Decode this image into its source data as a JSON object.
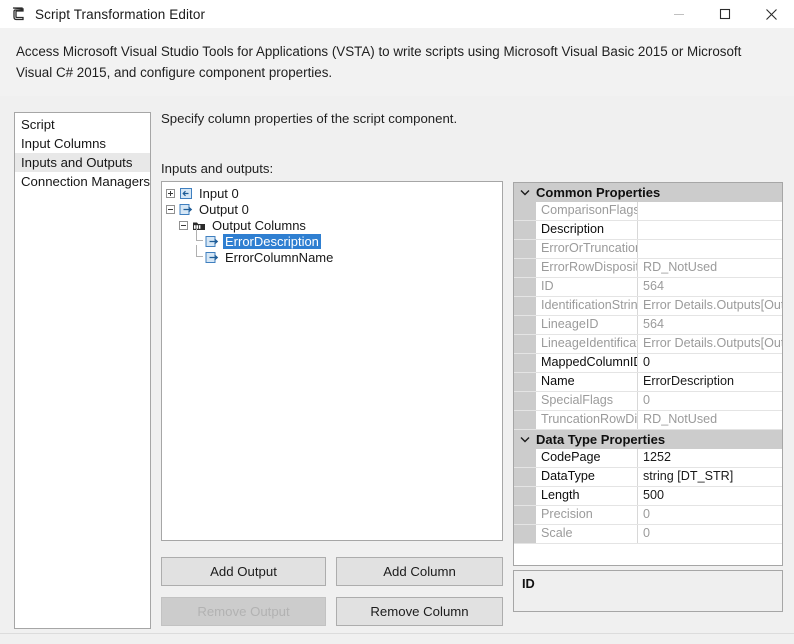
{
  "window": {
    "title": "Script Transformation Editor",
    "icon": "script-transformation-icon",
    "controls": {
      "minimize": "minimize-icon",
      "maximize": "maximize-icon",
      "close": "close-icon"
    }
  },
  "header": {
    "description": "Access Microsoft Visual Studio Tools for Applications (VSTA) to write scripts using Microsoft Visual Basic 2015 or Microsoft Visual C# 2015, and configure component properties."
  },
  "nav": {
    "items": [
      {
        "label": "Script",
        "selected": false
      },
      {
        "label": "Input Columns",
        "selected": false
      },
      {
        "label": "Inputs and Outputs",
        "selected": true
      },
      {
        "label": "Connection Managers",
        "selected": false
      }
    ]
  },
  "main": {
    "instruction": "Specify column properties of the script component.",
    "tree_label": "Inputs and outputs:"
  },
  "tree": {
    "nodes": [
      {
        "label": "Input 0",
        "depth": 0,
        "expander": "plus",
        "icon": "input-icon",
        "selected": false
      },
      {
        "label": "Output 0",
        "depth": 0,
        "expander": "minus",
        "icon": "output-icon",
        "selected": false
      },
      {
        "label": "Output Columns",
        "depth": 1,
        "expander": "minus",
        "icon": "folder-columns-icon",
        "selected": false
      },
      {
        "label": "ErrorDescription",
        "depth": 2,
        "expander": "none",
        "icon": "column-icon",
        "selected": true
      },
      {
        "label": "ErrorColumnName",
        "depth": 2,
        "expander": "none",
        "icon": "column-icon",
        "selected": false
      }
    ],
    "selection_color": "#2f7fd1"
  },
  "buttons": {
    "add_output": "Add Output",
    "add_column": "Add Column",
    "remove_output": "Remove Output",
    "remove_column": "Remove Column",
    "remove_output_disabled": true
  },
  "property_grid": {
    "categories": [
      {
        "name": "Common Properties",
        "chevron": "chevron-down-icon",
        "rows": [
          {
            "name": "ComparisonFlags",
            "value": "",
            "readonly": true
          },
          {
            "name": "Description",
            "value": "",
            "readonly": false
          },
          {
            "name": "ErrorOrTruncationO",
            "value": "",
            "readonly": true
          },
          {
            "name": "ErrorRowDispositio",
            "value": "RD_NotUsed",
            "readonly": true
          },
          {
            "name": "ID",
            "value": "564",
            "readonly": true
          },
          {
            "name": "IdentificationString",
            "value": "Error Details.Outputs[Outp",
            "readonly": true
          },
          {
            "name": "LineageID",
            "value": "564",
            "readonly": true
          },
          {
            "name": "LineageIdentificatic",
            "value": "Error Details.Outputs[Outp",
            "readonly": true
          },
          {
            "name": "MappedColumnID",
            "value": "0",
            "readonly": false
          },
          {
            "name": "Name",
            "value": "ErrorDescription",
            "readonly": false
          },
          {
            "name": "SpecialFlags",
            "value": "0",
            "readonly": true
          },
          {
            "name": "TruncationRowDisp",
            "value": "RD_NotUsed",
            "readonly": true
          }
        ]
      },
      {
        "name": "Data Type Properties",
        "chevron": "chevron-down-icon",
        "rows": [
          {
            "name": "CodePage",
            "value": "1252",
            "readonly": false
          },
          {
            "name": "DataType",
            "value": "string [DT_STR]",
            "readonly": false
          },
          {
            "name": "Length",
            "value": "500",
            "readonly": false
          },
          {
            "name": "Precision",
            "value": "0",
            "readonly": true
          },
          {
            "name": "Scale",
            "value": "0",
            "readonly": true
          }
        ]
      }
    ]
  },
  "description_pane": {
    "title": "ID"
  }
}
